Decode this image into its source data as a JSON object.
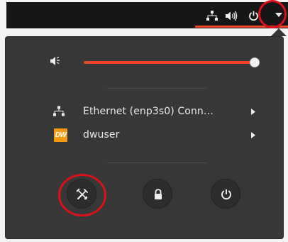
{
  "topbar": {
    "icons": [
      "network-wired-icon",
      "volume-high-icon",
      "power-icon",
      "menu-arrow-down-icon"
    ],
    "highlight_color": "#ec4622",
    "annotation_color": "#d9121a"
  },
  "menu": {
    "volume": {
      "icon": "volume-muted-icon",
      "level_percent": 100
    },
    "items": [
      {
        "icon": "network-wired-icon",
        "label": "Ethernet (enp3s0) Conn…",
        "has_submenu": true
      },
      {
        "icon": "dw-logo",
        "logo_text": "DW",
        "label": "dwuser",
        "has_submenu": true
      }
    ],
    "actions": [
      {
        "name": "settings",
        "icon": "settings-tools-icon"
      },
      {
        "name": "lock",
        "icon": "lock-icon"
      },
      {
        "name": "power",
        "icon": "power-icon"
      }
    ],
    "accent_color": "#ec4622"
  }
}
